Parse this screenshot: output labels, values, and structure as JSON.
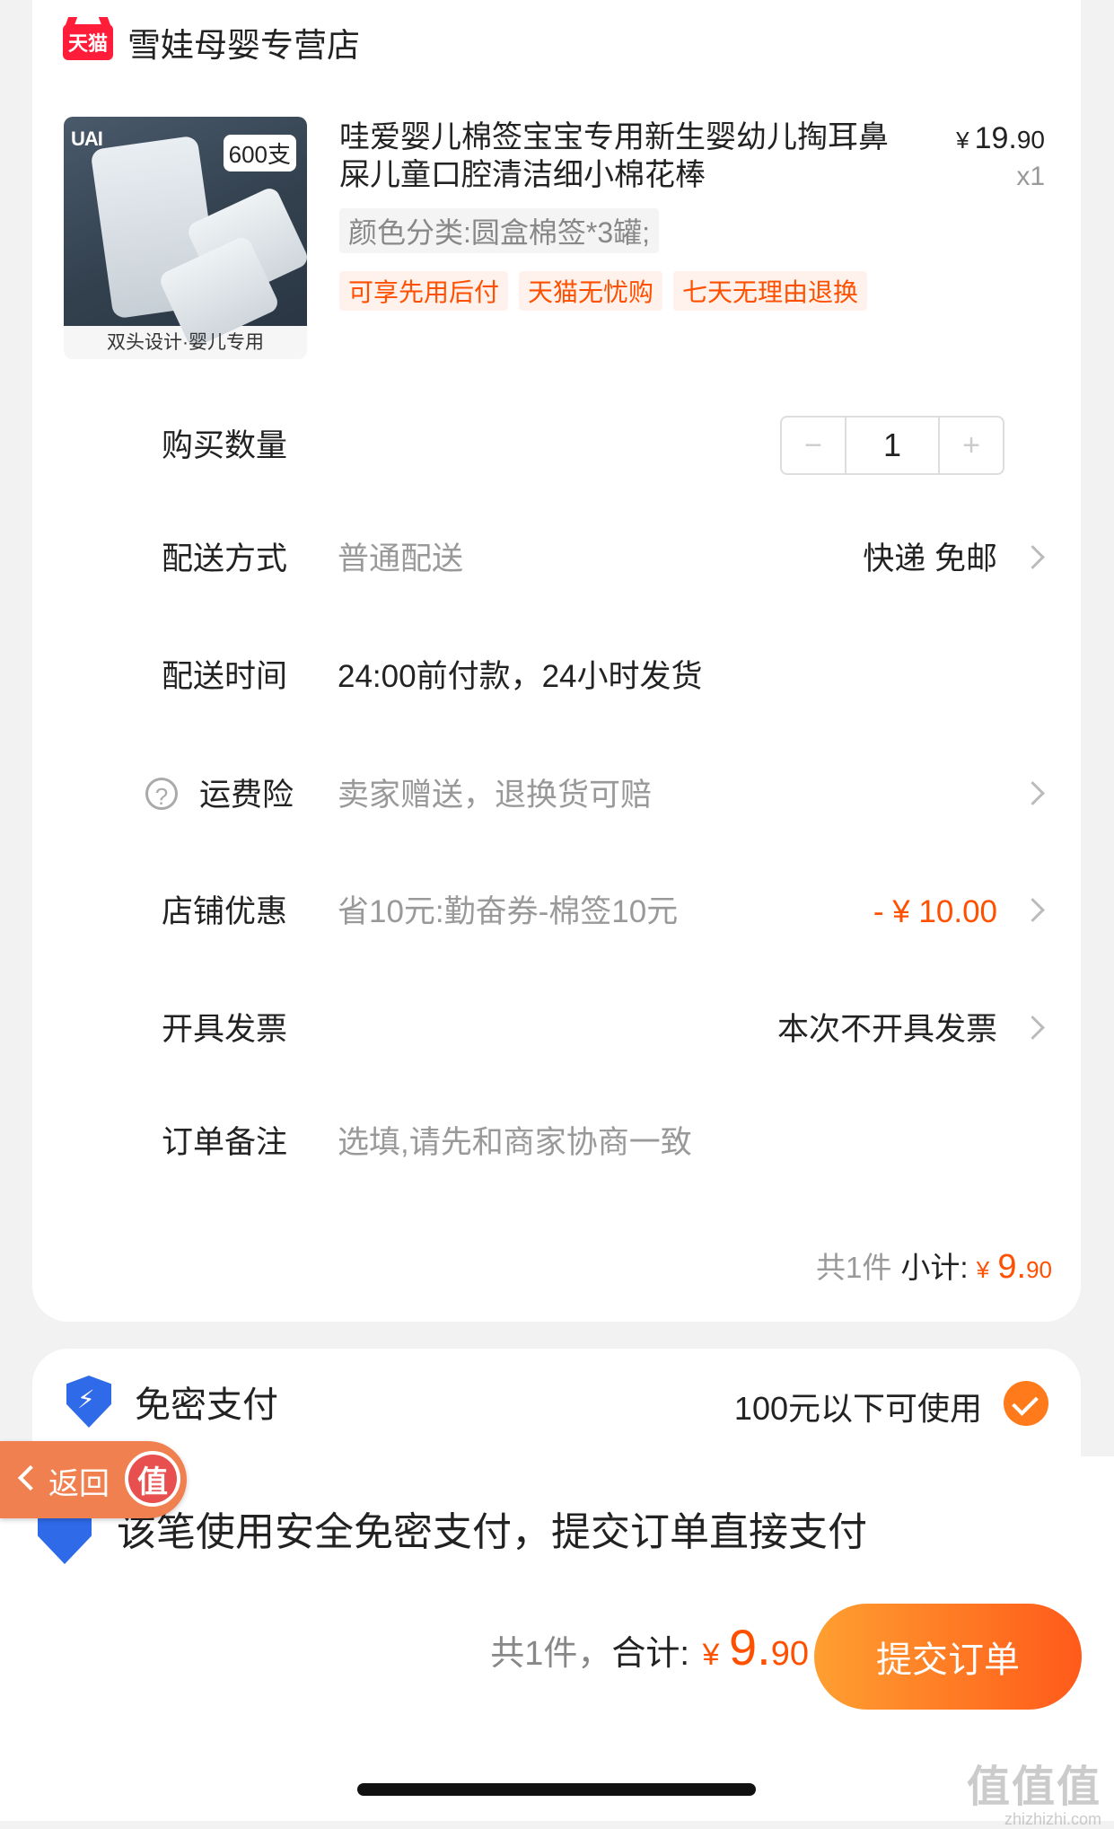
{
  "store": {
    "logo_text": "天猫",
    "name": "雪娃母婴专营店"
  },
  "product": {
    "thumb_brand": "UAI",
    "thumb_badge": "600支",
    "thumb_caption": "双头设计·婴儿专用",
    "title": "哇爱婴儿棉签宝宝专用新生婴幼儿掏耳鼻屎儿童口腔清洁细小棉花棒",
    "price_currency": "¥",
    "price_int": "19.",
    "price_dec": "90",
    "quantity_label": "x1",
    "sku": "颜色分类:圆盒棉签*3罐;",
    "tags": [
      "可享先用后付",
      "天猫无忧购",
      "七天无理由退换"
    ]
  },
  "rows": {
    "quantity": {
      "label": "购买数量",
      "minus": "−",
      "value": "1",
      "plus": "+"
    },
    "delivery": {
      "label": "配送方式",
      "value": "普通配送",
      "right": "快递 免邮"
    },
    "delivery_time": {
      "label": "配送时间",
      "value": "24:00前付款，24小时发货"
    },
    "shipping_insurance": {
      "label": "运费险",
      "help": "?",
      "value": "卖家赠送，退换货可赔"
    },
    "store_discount": {
      "label": "店铺优惠",
      "value": "省10元:勤奋券-棉签10元",
      "right": "- ¥ 10.00"
    },
    "invoice": {
      "label": "开具发票",
      "right": "本次不开具发票"
    },
    "note": {
      "label": "订单备注",
      "placeholder": "选填,请先和商家协商一致"
    }
  },
  "subtotal": {
    "count": "共1件",
    "label": "小计:",
    "currency": "¥",
    "int": "9.",
    "dec": "90"
  },
  "payment": {
    "label": "免密支付",
    "limit": "100元以下可使用"
  },
  "bottom": {
    "secure_text": "该笔使用安全免密支付，提交订单直接支付",
    "count": "共1件，",
    "total_label": "合计:",
    "currency": "¥",
    "int": "9.",
    "dec": "90",
    "submit_label": "提交订单"
  },
  "overlay": {
    "back_label": "返回",
    "badge": "值"
  },
  "watermark": {
    "big": "值值值",
    "small": "zhizhizhi.com"
  },
  "colors": {
    "accent": "#ff5000",
    "button_start": "#ff9f30",
    "button_end": "#ff5a1a",
    "shield": "#2f6ae8"
  }
}
